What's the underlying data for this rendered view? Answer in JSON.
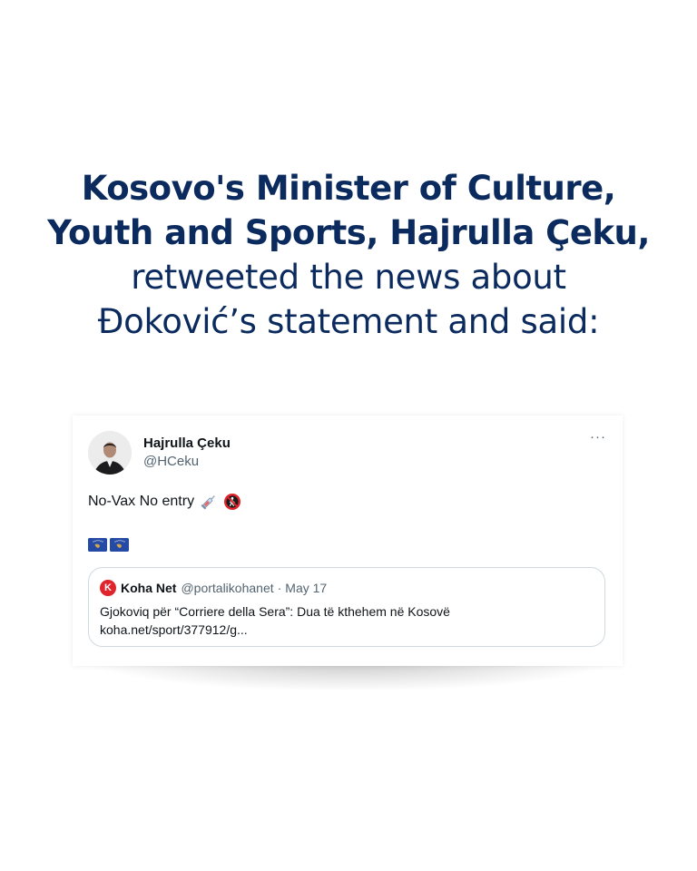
{
  "heading": {
    "line1": "Kosovo's Minister of Culture,",
    "line2": "Youth and Sports, Hajrulla Çeku,",
    "line3": "retweeted the news about",
    "line4": "Đoković’s statement and said:"
  },
  "colors": {
    "heading": "#0b2a5e",
    "tweet_text": "#0f1419",
    "secondary_text": "#536471",
    "border": "#cfd9de",
    "koha_red": "#e0242b",
    "kosovo_blue": "#244aa5",
    "kosovo_gold": "#d0a650"
  },
  "tweet": {
    "display_name": "Hajrulla Çeku",
    "handle": "@HCeku",
    "text": "No-Vax No entry",
    "emojis": [
      "syringe-icon",
      "no-pedestrians-icon"
    ],
    "flags": [
      "kosovo-flag-icon",
      "kosovo-flag-icon"
    ],
    "more_icon": "···"
  },
  "quote": {
    "logo_letter": "K",
    "name": "Koha Net",
    "handle": "@portalikohanet",
    "separator": "·",
    "date": "May 17",
    "text": "Gjokoviq për “Corriere della Sera”: Dua të kthehem në Kosovë",
    "link": "koha.net/sport/377912/g..."
  }
}
